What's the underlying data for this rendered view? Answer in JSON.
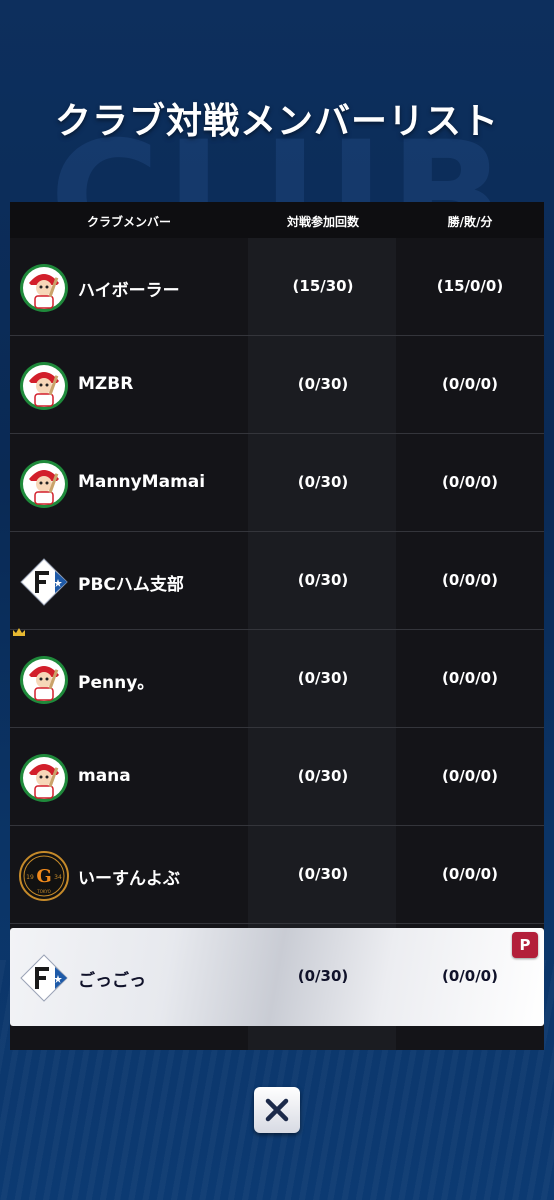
{
  "page": {
    "title": "クラブ対戦メンバーリスト",
    "background_text": "CLUB"
  },
  "table": {
    "headers": {
      "member": "クラブメンバー",
      "participation": "対戦参加回数",
      "record": "勝/敗/分"
    },
    "rows": [
      {
        "name": "ハイボーラー",
        "participation": "(15/30)",
        "record": "(15/0/0)",
        "team_icon": "carp-mascot-icon"
      },
      {
        "name": "MZBR",
        "participation": "(0/30)",
        "record": "(0/0/0)",
        "team_icon": "carp-mascot-icon"
      },
      {
        "name": "MannyMamai",
        "participation": "(0/30)",
        "record": "(0/0/0)",
        "team_icon": "carp-mascot-icon"
      },
      {
        "name": "PBCハム支部",
        "participation": "(0/30)",
        "record": "(0/0/0)",
        "team_icon": "fighters-f-logo-icon"
      },
      {
        "name": "Penny。",
        "participation": "(0/30)",
        "record": "(0/0/0)",
        "team_icon": "carp-mascot-icon",
        "leader": true
      },
      {
        "name": "mana",
        "participation": "(0/30)",
        "record": "(0/0/0)",
        "team_icon": "carp-mascot-icon"
      },
      {
        "name": "いーすんよぶ",
        "participation": "(0/30)",
        "record": "(0/0/0)",
        "team_icon": "giants-g-logo-icon",
        "logo_text": {
          "left": "19",
          "right": "34",
          "bottom": "TOKYO"
        }
      },
      {
        "name": "ごっごっ",
        "participation": "(0/30)",
        "record": "(0/0/0)",
        "team_icon": "fighters-f-logo-icon",
        "highlighted": true,
        "badge": "P"
      }
    ]
  },
  "colors": {
    "badge": "#b31f3a",
    "highlight_text": "#10122a",
    "carp_red": "#d21f2b",
    "carp_green": "#1f8a3b",
    "giants_orange": "#f08a1c"
  }
}
